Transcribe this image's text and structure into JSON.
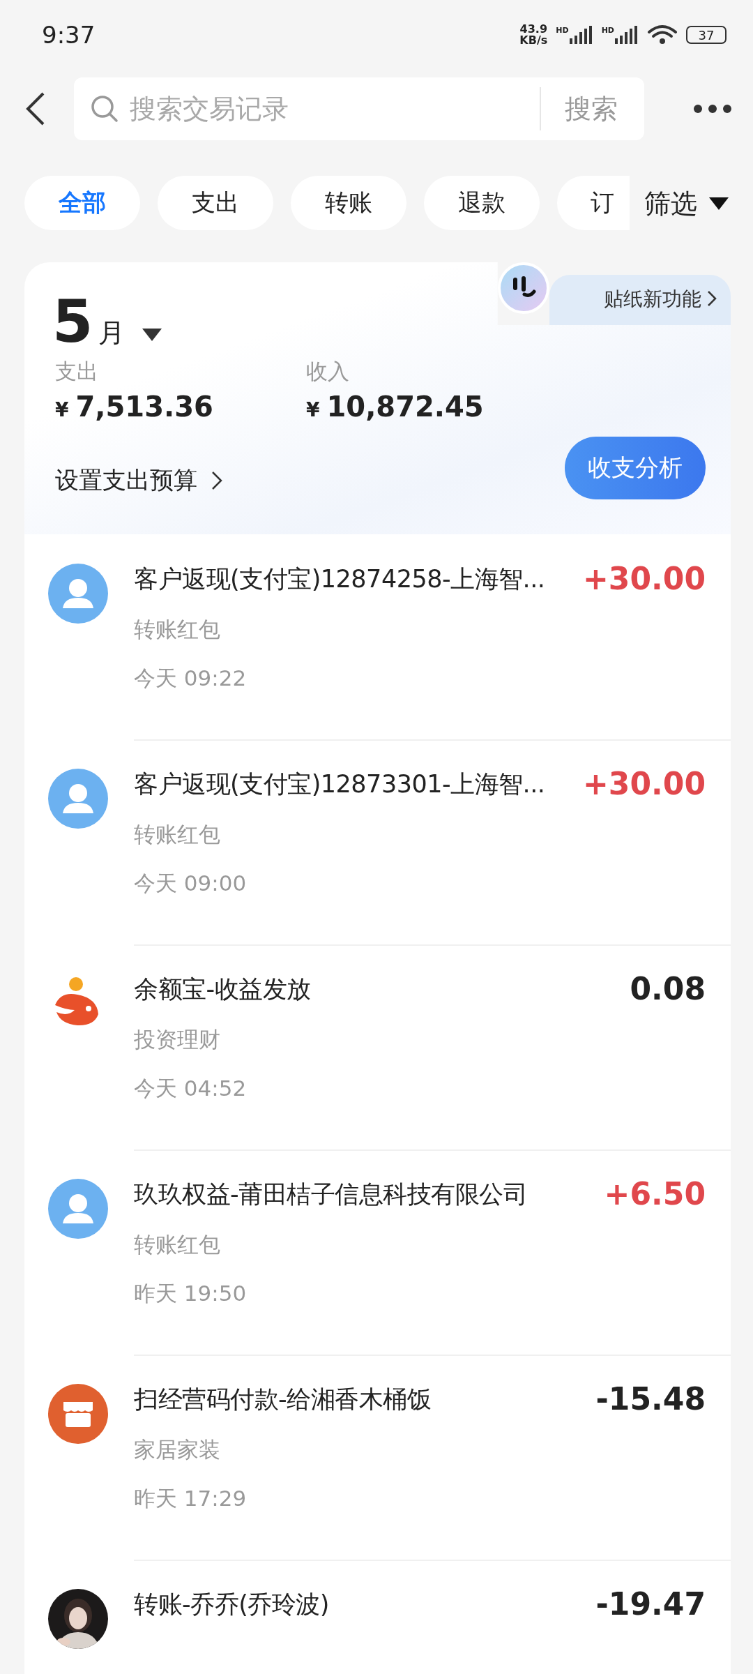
{
  "status_bar": {
    "time": "9:37",
    "net_speed": "43.9",
    "net_unit": "KB/s",
    "sim_labels": [
      "HD",
      "HD"
    ],
    "battery": "37"
  },
  "search": {
    "placeholder": "搜索交易记录",
    "button": "搜索"
  },
  "filters": [
    {
      "label": "全部",
      "selected": true
    },
    {
      "label": "支出",
      "selected": false
    },
    {
      "label": "转账",
      "selected": false
    },
    {
      "label": "退款",
      "selected": false
    },
    {
      "label": "订",
      "selected": false
    }
  ],
  "filter_button": "筛选",
  "summary": {
    "month_number": "5",
    "month_unit": "月",
    "sticker_promo": "贴纸新功能",
    "expense_label": "支出",
    "expense_currency": "¥",
    "expense": "7,513.36",
    "income_label": "收入",
    "income_currency": "¥",
    "income": "10,872.45",
    "budget_link": "设置支出预算",
    "analysis_button": "收支分析"
  },
  "transactions": [
    {
      "avatar": {
        "kind": "person"
      },
      "title": "客户返现(支付宝)12874258-上海智...",
      "category": "转账红包",
      "time": "今天 09:22",
      "amount": "+30.00",
      "kind": "income"
    },
    {
      "avatar": {
        "kind": "person"
      },
      "title": "客户返现(支付宝)12873301-上海智...",
      "category": "转账红包",
      "time": "今天 09:00",
      "amount": "+30.00",
      "kind": "income"
    },
    {
      "avatar": {
        "kind": "fund"
      },
      "title": "余额宝-收益发放",
      "category": "投资理财",
      "time": "今天 04:52",
      "amount": "0.08",
      "kind": "neutral"
    },
    {
      "avatar": {
        "kind": "person"
      },
      "title": "玖玖权益-莆田桔子信息科技有限公司",
      "category": "转账红包",
      "time": "昨天 19:50",
      "amount": "+6.50",
      "kind": "income"
    },
    {
      "avatar": {
        "kind": "shop"
      },
      "title": "扫经营码付款-给湘香木桶饭",
      "category": "家居家装",
      "time": "昨天 17:29",
      "amount": "-15.48",
      "kind": "expense"
    },
    {
      "title": "转账-乔乔(乔玲波)",
      "amount": "-19.47",
      "kind": "expense"
    }
  ]
}
